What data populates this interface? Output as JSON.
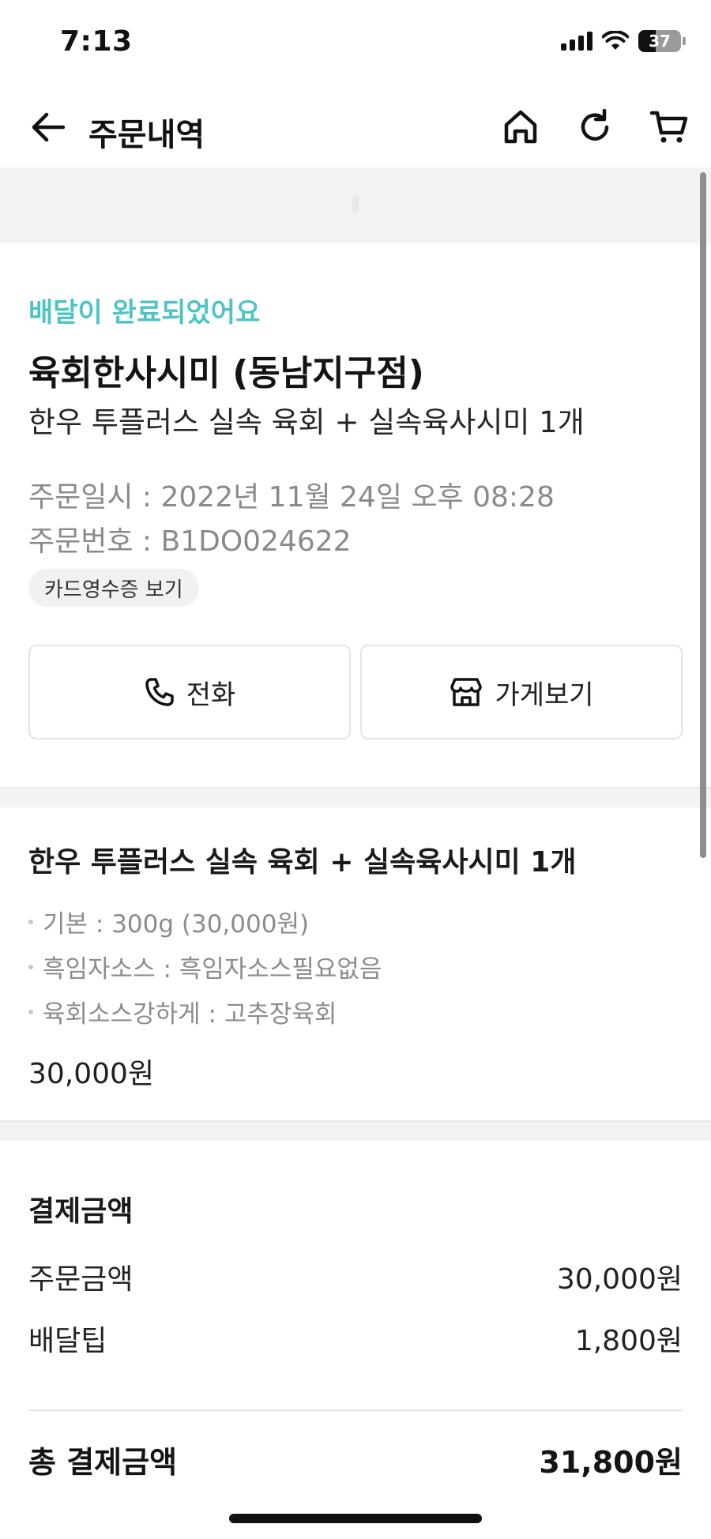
{
  "status_bar": {
    "time": "7:13",
    "battery": "37"
  },
  "header": {
    "title": "주문내역",
    "icons": [
      "back-arrow-icon",
      "home-icon",
      "refresh-icon",
      "cart-icon"
    ]
  },
  "order": {
    "status": "배달이 완료되었어요",
    "store_name": "육회한사시미 (동남지구점)",
    "items_summary": "한우 투플러스 실속 육회 + 실속육사시미 1개",
    "date": "주문일시 : 2022년 11월 24일 오후 08:28",
    "number": "주문번호 : B1DO024622",
    "receipt_label": "카드영수증 보기",
    "call_label": "전화",
    "store_label": "가게보기"
  },
  "menu": {
    "title": "한우 투플러스 실속 육회 + 실속육사시미 1개",
    "options": [
      "기본 : 300g (30,000원)",
      "흑임자소스 : 흑임자소스필요없음",
      "육회소스강하게 : 고추장육회"
    ],
    "price": "30,000원"
  },
  "payment": {
    "title": "결제금액",
    "order_amount_label": "주문금액",
    "order_amount": "30,000원",
    "delivery_tip_label": "배달팁",
    "delivery_tip": "1,800원",
    "total_label": "총 결제금액",
    "total": "31,800원"
  },
  "colors": {
    "accent": "#4fc4c4",
    "muted_text": "#8a8a8a",
    "section_bg": "#f2f3f5"
  }
}
